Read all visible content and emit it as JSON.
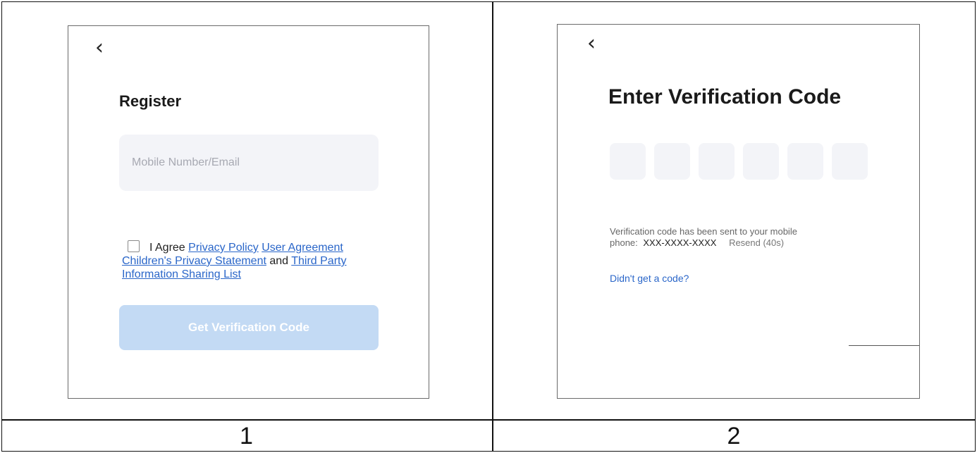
{
  "panel1": {
    "back_glyph": "‹",
    "title": "Register",
    "input_placeholder": "Mobile Number/Email",
    "agree_text": "I Agree",
    "links": {
      "privacy_policy": "Privacy Policy",
      "user_agreement": "User Agreement",
      "children_privacy": "Children's Privacy Statement",
      "third_party": "Third Party Information Sharing List"
    },
    "and_text": "and",
    "button_label": "Get Verification Code"
  },
  "panel2": {
    "back_glyph": "‹",
    "title": "Enter Verification Code",
    "code_boxes": 6,
    "info_line1": "Verification code has been sent to your mobile",
    "info_prefix": "phone:",
    "phone_mask": "XXX-XXXX-XXXX",
    "resend_label": "Resend (40s)",
    "no_code_link": "Didn't get a code?"
  },
  "captions": {
    "left": "1",
    "right": "2"
  },
  "colors": {
    "accent": "#2a66c9",
    "disabled_button": "#c3daf4",
    "field_bg": "#f3f4f8"
  }
}
